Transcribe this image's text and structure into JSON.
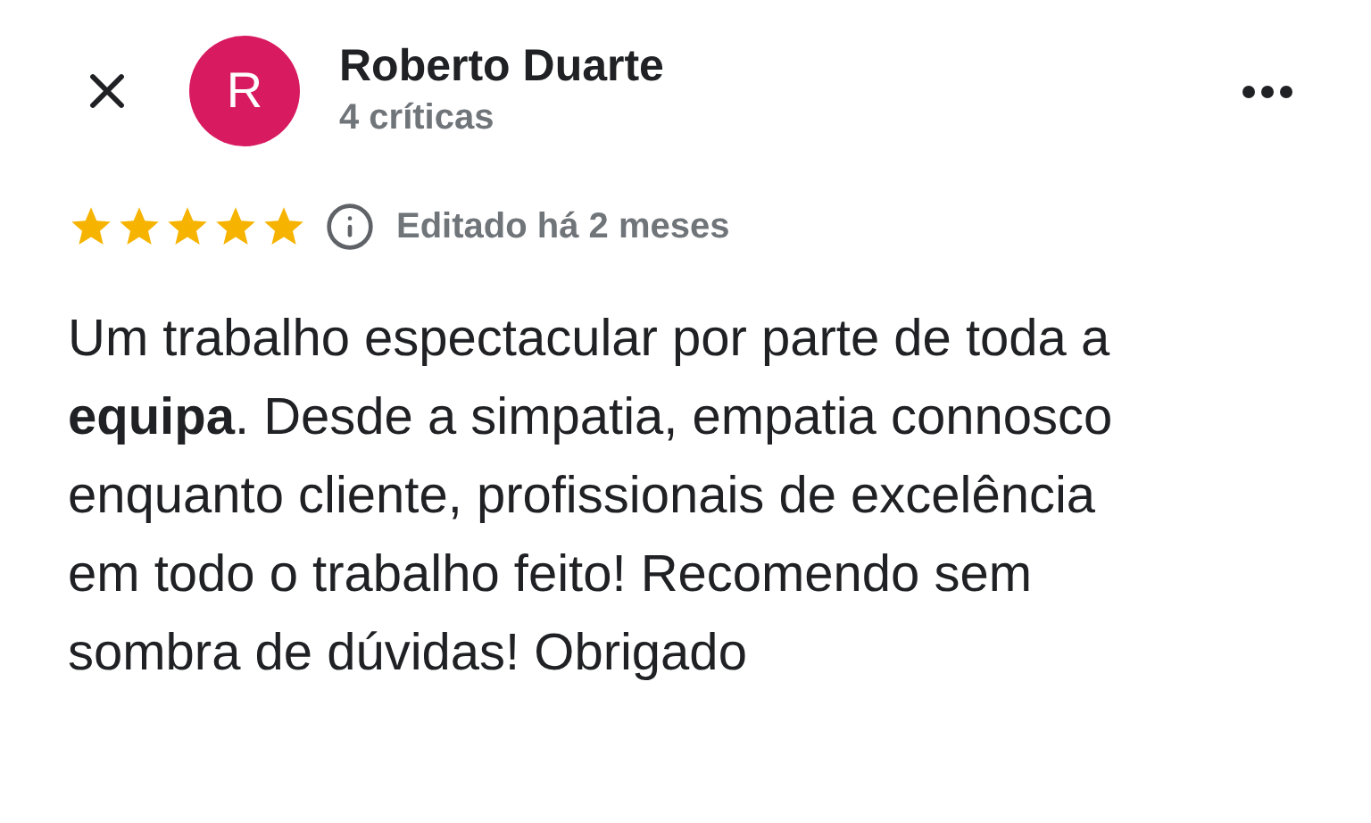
{
  "reviewer": {
    "initial": "R",
    "name": "Roberto Duarte",
    "reviews": "4 críticas"
  },
  "rating": {
    "stars": 5,
    "edited": "Editado há 2 meses"
  },
  "body": "Um trabalho espectacular por parte de toda a **equipa**. Desde a simpatia, empatia connosco enquanto cliente, profissionais de excelência em todo o trabalho feito! Recomendo sem sombra de dúvidas! Obrigado"
}
